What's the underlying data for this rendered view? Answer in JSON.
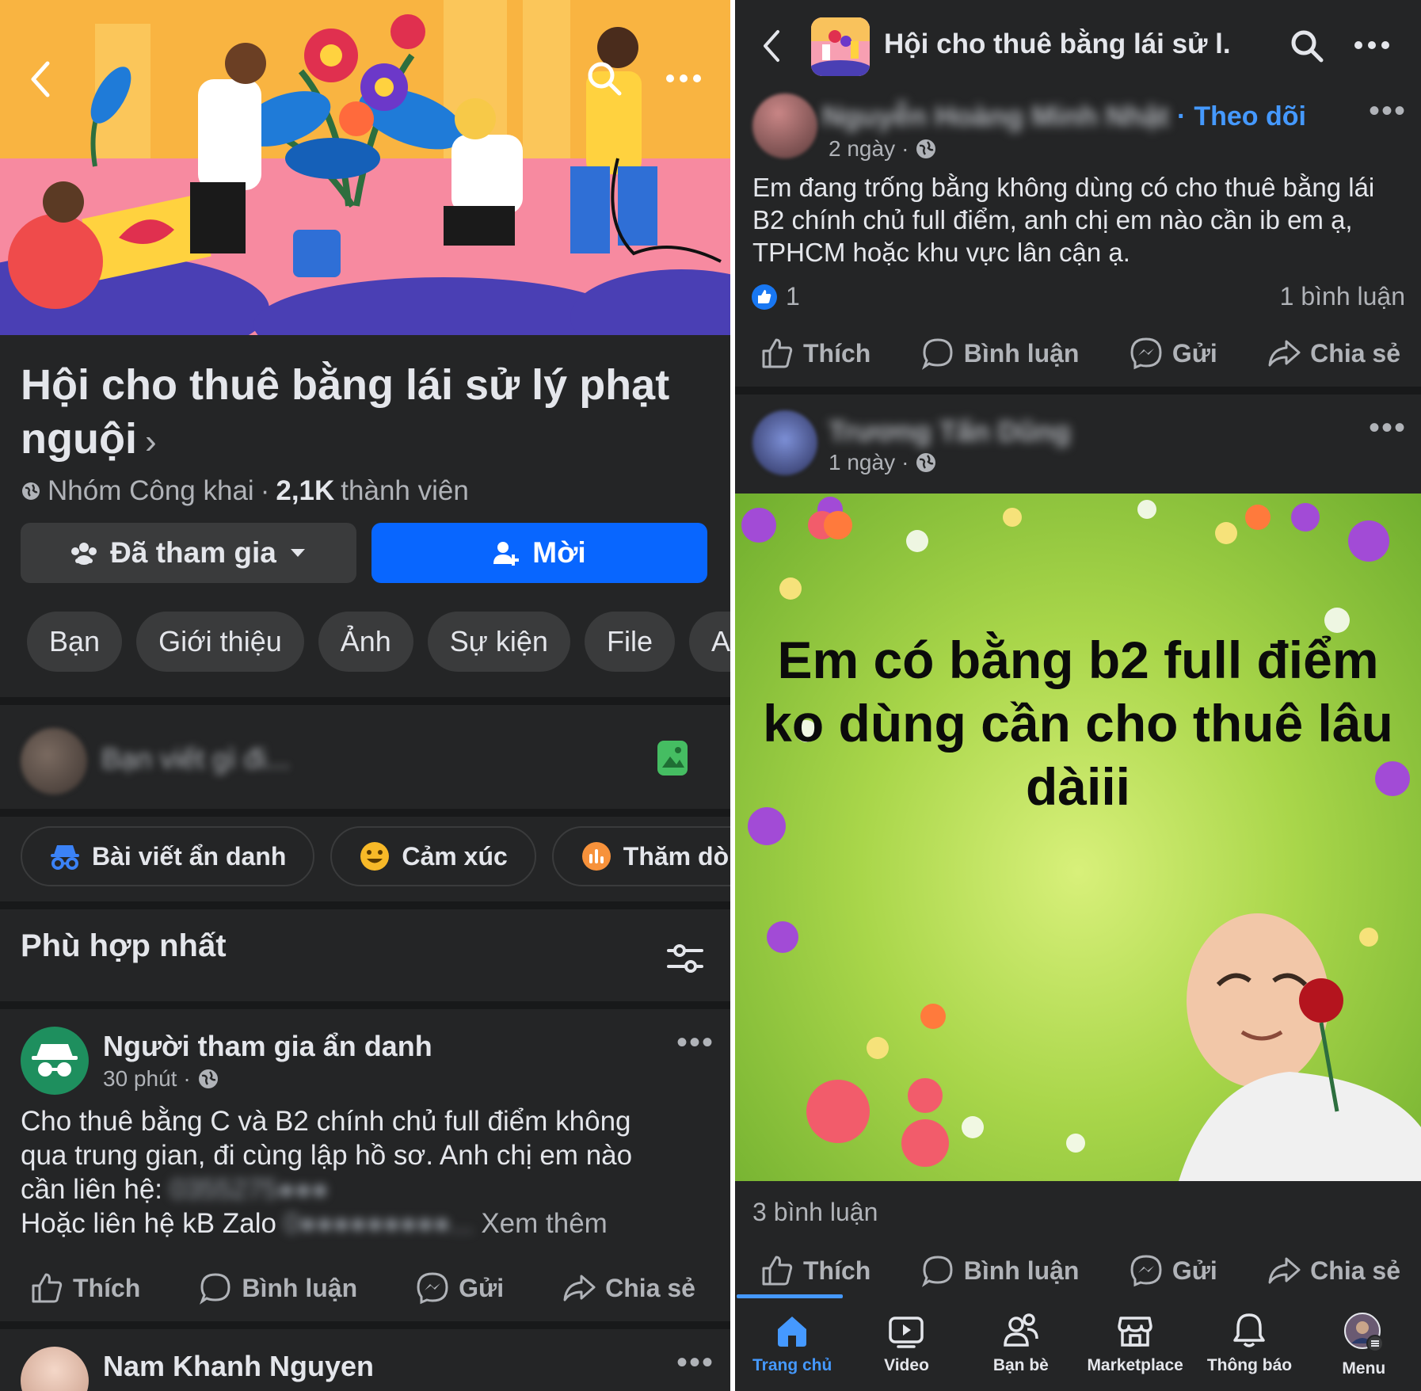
{
  "left": {
    "group": {
      "title": "Hội cho thuê bằng lái sử lý phạt nguội",
      "title_chevron": "›",
      "privacy": "Nhóm Công khai",
      "separator": "·",
      "members_count": "2,1K",
      "members_label": "thành viên"
    },
    "buttons": {
      "joined_label": "Đã tham gia",
      "invite_label": "Mời"
    },
    "tabs": [
      "Bạn",
      "Giới thiệu",
      "Ảnh",
      "Sự kiện",
      "File",
      "Al"
    ],
    "composer": {
      "placeholder": "Bạn viết gì đi..."
    },
    "quick_actions": [
      "Bài viết ẩn danh",
      "Cảm xúc",
      "Thăm dò ý"
    ],
    "sort_title": "Phù hợp nhất",
    "post1": {
      "author": "Người tham gia ẩn danh",
      "time": "30 phút",
      "dot": "·",
      "line1": "Cho thuê bằng C và B2 chính chủ full điểm không",
      "line2": "qua trung gian, đi cùng lập hồ sơ. Anh chị em nào",
      "line3_prefix": "cần liên hệ: ",
      "line3_blurred": "0355275●●●",
      "line4_prefix": "Hoặc liên hệ kB Zalo ",
      "line4_blurred": "0●●●●●●●●●...",
      "see_more": "Xem thêm"
    },
    "actions": {
      "like": "Thích",
      "comment": "Bình luận",
      "send": "Gửi",
      "share": "Chia sẻ"
    },
    "post2": {
      "author": "Nam Khanh Nguyen"
    }
  },
  "right": {
    "topbar": {
      "title": "Hội cho thuê bằng lái sử l..."
    },
    "post1": {
      "author_blurred": "Nguyễn Hoàng Minh Nhật",
      "follow": "Theo dõi",
      "dot": "·",
      "time": "2 ngày",
      "text": "Em đang trống bằng không dùng có cho thuê bằng lái B2 chính chủ full điểm, anh chị em nào cần ib em ạ, TPHCM hoặc khu vực lân cận ạ.",
      "likes": "1",
      "comments": "1 bình luận"
    },
    "post2": {
      "author_blurred": "Trương Tấn Dũng",
      "time": "1 ngày",
      "dot": "·",
      "image_text": "Em có bằng b2 full điểm ko dùng cần cho thuê lâu dàiii",
      "comments": "3 bình luận"
    },
    "actions": {
      "like": "Thích",
      "comment": "Bình luận",
      "send": "Gửi",
      "share": "Chia sẻ"
    },
    "nav": [
      {
        "label": "Trang chủ",
        "icon": "home-icon"
      },
      {
        "label": "Video",
        "icon": "video-icon"
      },
      {
        "label": "Bạn bè",
        "icon": "friends-icon"
      },
      {
        "label": "Marketplace",
        "icon": "marketplace-icon"
      },
      {
        "label": "Thông báo",
        "icon": "bell-icon"
      },
      {
        "label": "Menu",
        "icon": "profile-menu-icon"
      }
    ]
  },
  "colors": {
    "background": "#242526",
    "surface": "#3a3b3c",
    "primary_blue": "#0866ff",
    "link_blue": "#4599ff",
    "text": "#e4e6eb",
    "secondary_text": "#b0b3b8"
  }
}
